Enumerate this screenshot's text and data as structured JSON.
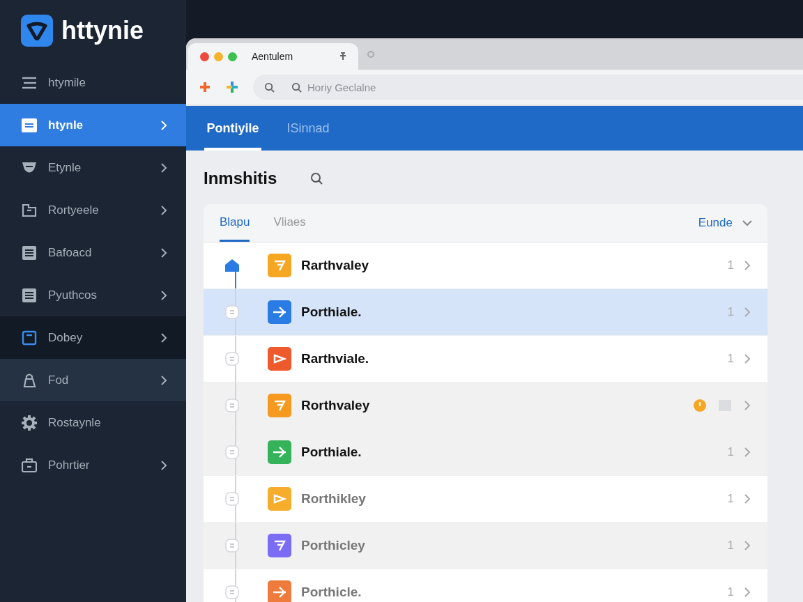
{
  "sidebar": {
    "logo": "httynie",
    "items": [
      {
        "label": "htymile",
        "selected": false,
        "pressed": false,
        "hovered": false,
        "chevron": false
      },
      {
        "label": "htynle",
        "selected": true,
        "pressed": false,
        "hovered": false,
        "chevron": true
      },
      {
        "label": "Etynle",
        "selected": false,
        "pressed": false,
        "hovered": false,
        "chevron": true
      },
      {
        "label": "Rortyeele",
        "selected": false,
        "pressed": false,
        "hovered": false,
        "chevron": true
      },
      {
        "label": "Bafoacd",
        "selected": false,
        "pressed": false,
        "hovered": false,
        "chevron": true
      },
      {
        "label": "Pyuthcos",
        "selected": false,
        "pressed": false,
        "hovered": false,
        "chevron": true
      },
      {
        "label": "Dobey",
        "selected": false,
        "pressed": true,
        "hovered": false,
        "chevron": true
      },
      {
        "label": "Fod",
        "selected": false,
        "pressed": false,
        "hovered": true,
        "chevron": true
      },
      {
        "label": "Rostaynle",
        "selected": false,
        "pressed": false,
        "hovered": false,
        "chevron": false
      },
      {
        "label": "Pohrtier",
        "selected": false,
        "pressed": false,
        "hovered": false,
        "chevron": true
      }
    ]
  },
  "browser": {
    "tab_title": "Aentulem",
    "address": {
      "placeholder": "Horiy Geclalne"
    }
  },
  "app_tabs": [
    {
      "label": "Pontiyile",
      "selected": true
    },
    {
      "label": "ISinnad",
      "selected": false
    }
  ],
  "heading": "Inmshitis",
  "card": {
    "tabs": [
      {
        "label": "Blapu",
        "selected": true
      },
      {
        "label": "Vliaes",
        "selected": false
      }
    ],
    "filter": "Eunde",
    "rows": [
      {
        "name": "Rarthvaley",
        "count": "1",
        "color": "#f5a623",
        "selected": false,
        "shaded": false,
        "dimmed": false,
        "alert": false
      },
      {
        "name": "Porthiale.",
        "count": "1",
        "color": "#2b7be4",
        "selected": true,
        "shaded": false,
        "dimmed": false,
        "alert": false
      },
      {
        "name": "Rarthviale.",
        "count": "1",
        "color": "#ee5a2c",
        "selected": false,
        "shaded": false,
        "dimmed": false,
        "alert": false
      },
      {
        "name": "Rorthvaley",
        "color": "#f59a1f",
        "selected": false,
        "shaded": true,
        "dimmed": false,
        "alert": true
      },
      {
        "name": "Porthiale.",
        "count": "1",
        "color": "#34b35a",
        "selected": false,
        "shaded": true,
        "dimmed": false,
        "alert": false
      },
      {
        "name": "Rorthikley",
        "count": "1",
        "color": "#f5ad2b",
        "selected": false,
        "shaded": false,
        "dimmed": true,
        "alert": false
      },
      {
        "name": "Porthicley",
        "count": "1",
        "color": "#7a6cf5",
        "selected": false,
        "shaded": true,
        "dimmed": true,
        "alert": false
      },
      {
        "name": "Porthicle.",
        "count": "1",
        "color": "#ee7a3c",
        "selected": false,
        "shaded": false,
        "dimmed": true,
        "alert": false
      }
    ]
  }
}
